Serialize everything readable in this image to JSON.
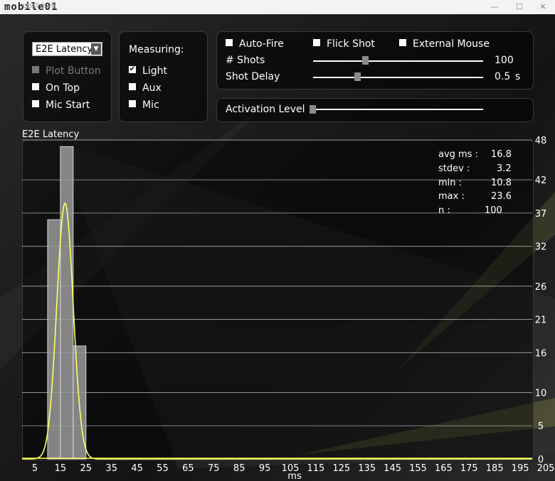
{
  "window": {
    "title": "LDAT 2.26",
    "logo_text": "mobile01",
    "minimize": "—",
    "maximize": "☐",
    "close": "✕"
  },
  "mode_panel": {
    "select_value": "E2E Latency",
    "plot_button": "Plot Button",
    "on_top": "On Top",
    "mic_start": "Mic Start"
  },
  "measuring_panel": {
    "title": "Measuring:",
    "light": "Light",
    "aux": "Aux",
    "mic": "Mic",
    "light_checked": true
  },
  "fire_panel": {
    "auto_fire": "Auto-Fire",
    "flick_shot": "Flick Shot",
    "external_mouse": "External Mouse",
    "shots_label": "# Shots",
    "shots_value": "100",
    "shots_fraction": 0.3,
    "delay_label": "Shot Delay",
    "delay_value": "0.5",
    "delay_unit": "s",
    "delay_fraction": 0.25
  },
  "activation_panel": {
    "label": "Activation Level",
    "fraction": 0.0
  },
  "stats": {
    "avg_label": "avg ms :",
    "avg_value": "16.8",
    "stdev_label": "stdev :",
    "stdev_value": "3.2",
    "min_label": "min :",
    "min_value": "10.8",
    "max_label": "max :",
    "max_value": "23.6",
    "n_label": "n :",
    "n_value": "100"
  },
  "colors": {
    "bar_fill": "#9a9a9a",
    "curve": "#ffff66",
    "grid": "#cfcfcf"
  },
  "chart_data": {
    "type": "bar",
    "title": "E2E Latency",
    "xlabel": "ms",
    "ylabel": "",
    "x_ticks": [
      5,
      15,
      25,
      35,
      45,
      55,
      65,
      75,
      85,
      95,
      105,
      115,
      125,
      135,
      145,
      155,
      165,
      175,
      185,
      195,
      205
    ],
    "y_ticks": [
      0,
      5,
      10,
      16,
      21,
      26,
      32,
      37,
      42,
      48
    ],
    "xlim": [
      0,
      205
    ],
    "ylim": [
      0,
      48
    ],
    "bins": [
      {
        "x0": 10,
        "x1": 15,
        "value": 36
      },
      {
        "x0": 15,
        "x1": 20,
        "value": 47
      },
      {
        "x0": 20,
        "x1": 25,
        "value": 17
      }
    ],
    "curve": {
      "type": "gaussian",
      "mean": 16.8,
      "stdev": 3.2,
      "peak": 38.5
    },
    "grid": true
  }
}
